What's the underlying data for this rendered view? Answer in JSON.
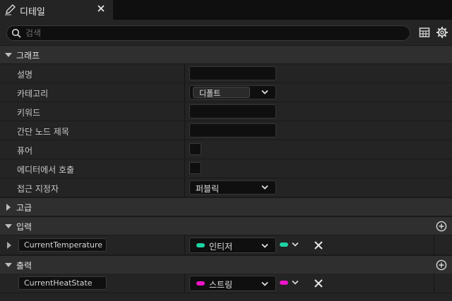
{
  "tab": {
    "title": "디테일",
    "icon": "pencil-icon",
    "close_icon": "close-icon"
  },
  "search": {
    "placeholder": "검색",
    "value": ""
  },
  "toolbar": {
    "table_icon": "table-icon",
    "settings_icon": "gear-icon"
  },
  "sections": {
    "graph": {
      "label": "그래프",
      "expanded": true
    },
    "advanced": {
      "label": "고급",
      "expanded": false
    },
    "inputs": {
      "label": "입력",
      "expanded": true
    },
    "outputs": {
      "label": "출력",
      "expanded": true
    }
  },
  "graph_properties": {
    "description": {
      "label": "설명",
      "value": ""
    },
    "category": {
      "label": "카테고리",
      "value": "디폴트"
    },
    "keywords": {
      "label": "키워드",
      "value": ""
    },
    "compact_node_title": {
      "label": "간단 노드 제목",
      "value": ""
    },
    "pure": {
      "label": "퓨어",
      "checked": false
    },
    "call_in_editor": {
      "label": "에디터에서 호출",
      "checked": false
    },
    "access_specifier": {
      "label": "접근 지정자",
      "value": "퍼블릭"
    }
  },
  "inputs": [
    {
      "name": "CurrentTemperature",
      "type": "인티저",
      "type_color": "#1fd3a3"
    }
  ],
  "outputs": [
    {
      "name": "CurrentHeatState",
      "type": "스트링",
      "type_color": "#ee14c8"
    }
  ]
}
